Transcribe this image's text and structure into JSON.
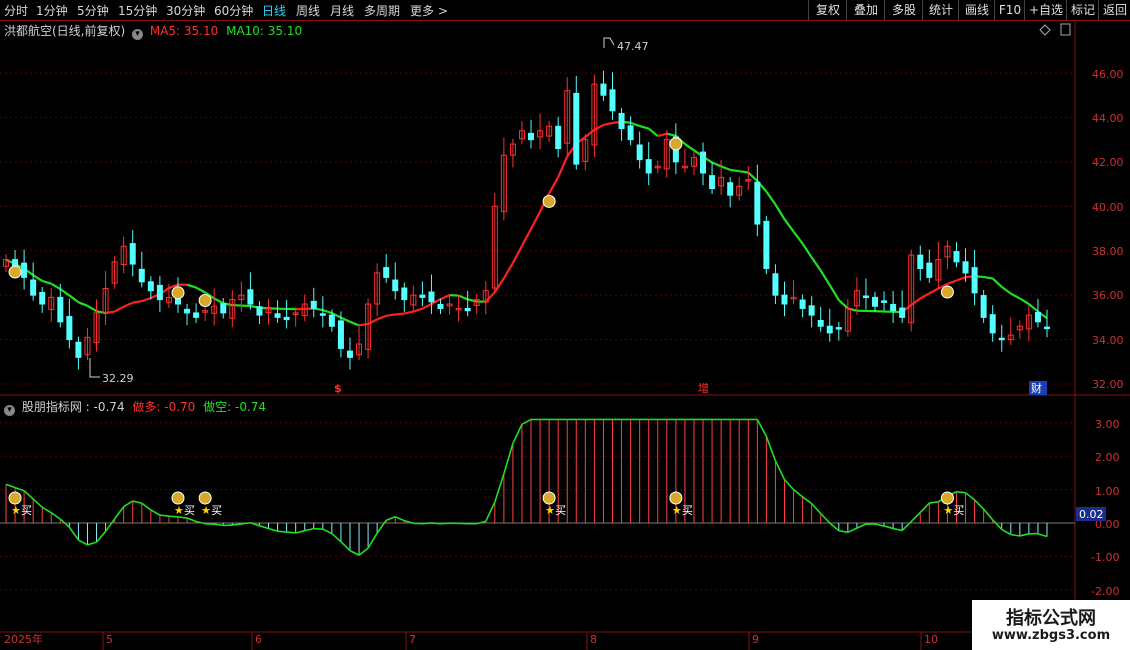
{
  "toolbar": {
    "periods": [
      "分时",
      "1分钟",
      "5分钟",
      "15分钟",
      "30分钟",
      "60分钟",
      "日线",
      "周线",
      "月线",
      "多周期",
      "更多 >"
    ],
    "active_period": "日线",
    "right_buttons": [
      "复权",
      "叠加",
      "多股",
      "统计",
      "画线",
      "F10",
      "+自选",
      "标记",
      "返回"
    ]
  },
  "main_chart": {
    "title": "洪都航空(日线,前复权)",
    "ma5_label": "MA5: 35.10",
    "ma10_label": "MA10: 35.10",
    "price_labels": [
      "46.00",
      "44.00",
      "42.00",
      "40.00",
      "38.00",
      "36.00",
      "34.00",
      "32.00"
    ],
    "high_annotation": "47.47",
    "low_annotation": "32.29",
    "event_markers": [
      "$",
      "增",
      "财"
    ]
  },
  "indicator": {
    "name": "股朋指标网",
    "value": ": -0.74",
    "long_label": "做多: -0.70",
    "short_label": "做空: -0.74",
    "y_labels": [
      "3.00",
      "2.00",
      "1.00",
      "0.00",
      "-1.00",
      "-2.00"
    ],
    "current_value": "0.02",
    "buy_label": "买"
  },
  "x_axis": {
    "labels": [
      "2025年",
      "5",
      "6",
      "7",
      "8",
      "9",
      "10"
    ]
  },
  "watermark": {
    "line1": "指标公式网",
    "line2": "www.zbgs3.com"
  },
  "colors": {
    "up": "#ff3030",
    "down": "#54ffff",
    "ma_red": "#ff2020",
    "ma_green": "#20e020",
    "grid": "#5a0000"
  },
  "chart_data": {
    "type": "candlestick",
    "x": [
      "2025-04",
      "2025-05",
      "2025-06",
      "2025-07",
      "2025-08",
      "2025-09",
      "2025-10"
    ],
    "price_ylim": [
      32,
      47.5
    ],
    "high": 47.47,
    "low": 32.29,
    "close_series": [
      37.6,
      37.2,
      36.8,
      36.0,
      35.6,
      35.9,
      34.8,
      34.0,
      33.2,
      34.1,
      35.2,
      36.3,
      37.5,
      38.2,
      37.4,
      36.6,
      36.2,
      35.8,
      35.9,
      35.6,
      35.2,
      35.0,
      35.3,
      35.5,
      35.2,
      35.8,
      36.0,
      35.6,
      35.1,
      35.4,
      35.0,
      34.9,
      35.2,
      35.6,
      35.4,
      35.1,
      34.6,
      33.6,
      33.2,
      33.8,
      35.6,
      37.0,
      36.8,
      36.2,
      35.8,
      36.0,
      35.9,
      35.7,
      35.4,
      35.6,
      35.4,
      35.3,
      35.8,
      36.2,
      40.0,
      42.3,
      42.8,
      43.4,
      43.0,
      43.4,
      43.6,
      42.6,
      45.2,
      41.9,
      43.0,
      45.5,
      45.0,
      44.3,
      43.5,
      43.0,
      42.1,
      41.5,
      41.8,
      43.0,
      42.0,
      41.8,
      42.2,
      41.5,
      40.8,
      41.3,
      40.5,
      40.9,
      41.2,
      39.2,
      37.2,
      36.0,
      35.6,
      35.9,
      35.4,
      35.1,
      34.6,
      34.3,
      34.5,
      35.4,
      36.2,
      35.9,
      35.5,
      35.7,
      35.3,
      35.0,
      37.8,
      37.2,
      36.8,
      37.6,
      38.2,
      37.5,
      37.0,
      36.1,
      35.0,
      34.3,
      34.0,
      34.2,
      34.6,
      35.1,
      34.8,
      34.5
    ]
  }
}
